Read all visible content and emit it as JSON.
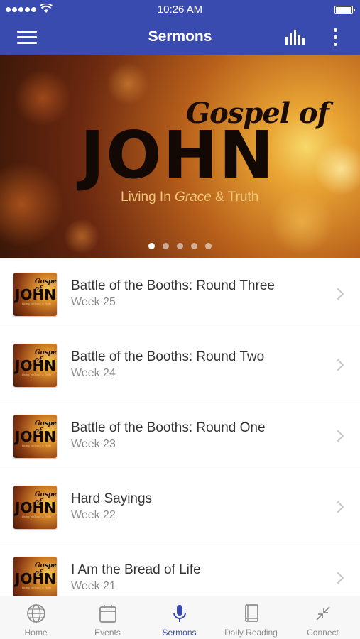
{
  "status_bar": {
    "time": "10:26 AM"
  },
  "header": {
    "title": "Sermons",
    "menu_icon": "hamburger-menu-icon",
    "audio_icon": "audio-bars-icon",
    "more_icon": "more-vertical-icon"
  },
  "banner": {
    "line1": "Gospel of",
    "line2": "JOHN",
    "tagline_part1": "Living In ",
    "tagline_em": "Grace",
    "tagline_part2": " & Truth",
    "slide_count": 5,
    "active_slide": 1
  },
  "sermons": [
    {
      "title": "Battle of the Booths: Round Three",
      "subtitle": "Week 25"
    },
    {
      "title": "Battle of the Booths: Round Two",
      "subtitle": "Week 24"
    },
    {
      "title": "Battle of the Booths: Round One",
      "subtitle": "Week 23"
    },
    {
      "title": "Hard Sayings",
      "subtitle": "Week 22"
    },
    {
      "title": "I Am the Bread of Life",
      "subtitle": "Week 21"
    }
  ],
  "thumbnail": {
    "gospel": "Gospel of",
    "john": "JOHN",
    "tagline": "Living In Grace & Truth"
  },
  "tabs": [
    {
      "label": "Home",
      "icon": "globe-icon"
    },
    {
      "label": "Events",
      "icon": "calendar-icon"
    },
    {
      "label": "Sermons",
      "icon": "microphone-icon"
    },
    {
      "label": "Daily Reading",
      "icon": "book-icon"
    },
    {
      "label": "Connect",
      "icon": "arrows-collapse-icon"
    }
  ],
  "active_tab": "Sermons",
  "colors": {
    "primary": "#3a4bb0",
    "inactive": "#8e8e8e",
    "tab_bar_bg": "#f7f7f7"
  }
}
